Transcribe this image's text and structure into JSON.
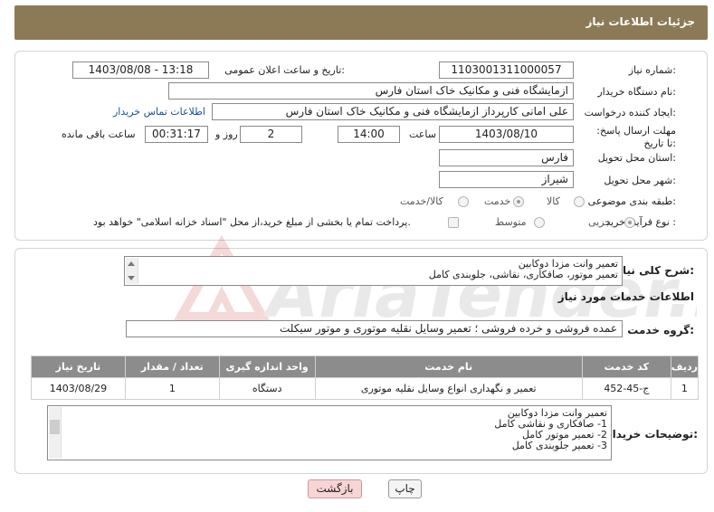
{
  "header": {
    "title": "جزئیات اطلاعات نیاز"
  },
  "fields": {
    "need_number": {
      "label": "شماره نیاز:",
      "value": "1103001311000057"
    },
    "announce_datetime": {
      "label": "تاریخ و ساعت اعلان عمومی:",
      "value": "1403/08/08 - 13:18"
    },
    "buyer_org": {
      "label": "نام دستگاه خریدار:",
      "value": "ازمایشگاه فنی و مکانیک خاک استان فارس"
    },
    "requester": {
      "label": "ایجاد کننده درخواست:",
      "value": "علی امانی کارپرداز ازمایشگاه فنی و مکانیک خاک استان فارس"
    },
    "contact_link": "اطلاعات تماس خریدار",
    "deadline": {
      "label": "مهلت ارسال پاسخ: تا تاریخ:",
      "date": "1403/08/10",
      "time_label": "ساعت",
      "time": "14:00",
      "days": "2",
      "days_label": "روز و",
      "remaining": "00:31:17",
      "remaining_label": "ساعت باقی مانده"
    },
    "province": {
      "label": "استان محل تحویل:",
      "value": "فارس"
    },
    "city": {
      "label": "شهر محل تحویل:",
      "value": "شیراز"
    },
    "category": {
      "label": "طبقه بندی موضوعی:",
      "options": [
        "کالا",
        "خدمت",
        "کالا/خدمت"
      ],
      "selected": "خدمت"
    },
    "purchase_type": {
      "label": "نوع فرآیند خرید :",
      "options": [
        "جزیی",
        "متوسط"
      ],
      "selected": "جزیی",
      "payment_note": "پرداخت تمام یا بخشی از مبلغ خرید،از محل \"اسناد خزانه اسلامی\" خواهد بود."
    }
  },
  "summary": {
    "label": "شرح کلی نیاز:",
    "lines": [
      "تعمیر وانت مزدا دوکابین",
      "تعمیر موتور، صافکاری، نقاشی، جلوبندی کامل"
    ]
  },
  "services_section": {
    "title": "اطلاعات خدمات مورد نیاز",
    "group_label": "گروه خدمت:",
    "group_value": "عمده فروشی و خرده فروشی ؛ تعمیر وسایل نقلیه موتوری و موتور سیکلت"
  },
  "table": {
    "headers": [
      "ردیف",
      "کد خدمت",
      "نام خدمت",
      "واحد اندازه گیری",
      "تعداد / مقدار",
      "تاریخ نیاز"
    ],
    "rows": [
      [
        "1",
        "ج-45-452",
        "تعمیر و نگهداری انواع وسایل نقلیه موتوری",
        "دستگاه",
        "1",
        "1403/08/29"
      ]
    ]
  },
  "buyer_notes": {
    "label": "توضیحات خریدار:",
    "lines": [
      "تعمیر وانت مزدا دوکابین",
      "1- صافکاری و نقاشی کامل",
      "2- تعمیر موتور کامل",
      "3- تعمیر جلوبندی کامل"
    ]
  },
  "buttons": {
    "print": "چاپ",
    "back": "بازگشت"
  },
  "watermark": {
    "text": "AriaTender.neT"
  },
  "colors": {
    "header_bg": "#8c7a56",
    "table_header_bg": "#8c8c8c",
    "link": "#1a4fa0",
    "back_button_bg": "#f8d4d4"
  }
}
